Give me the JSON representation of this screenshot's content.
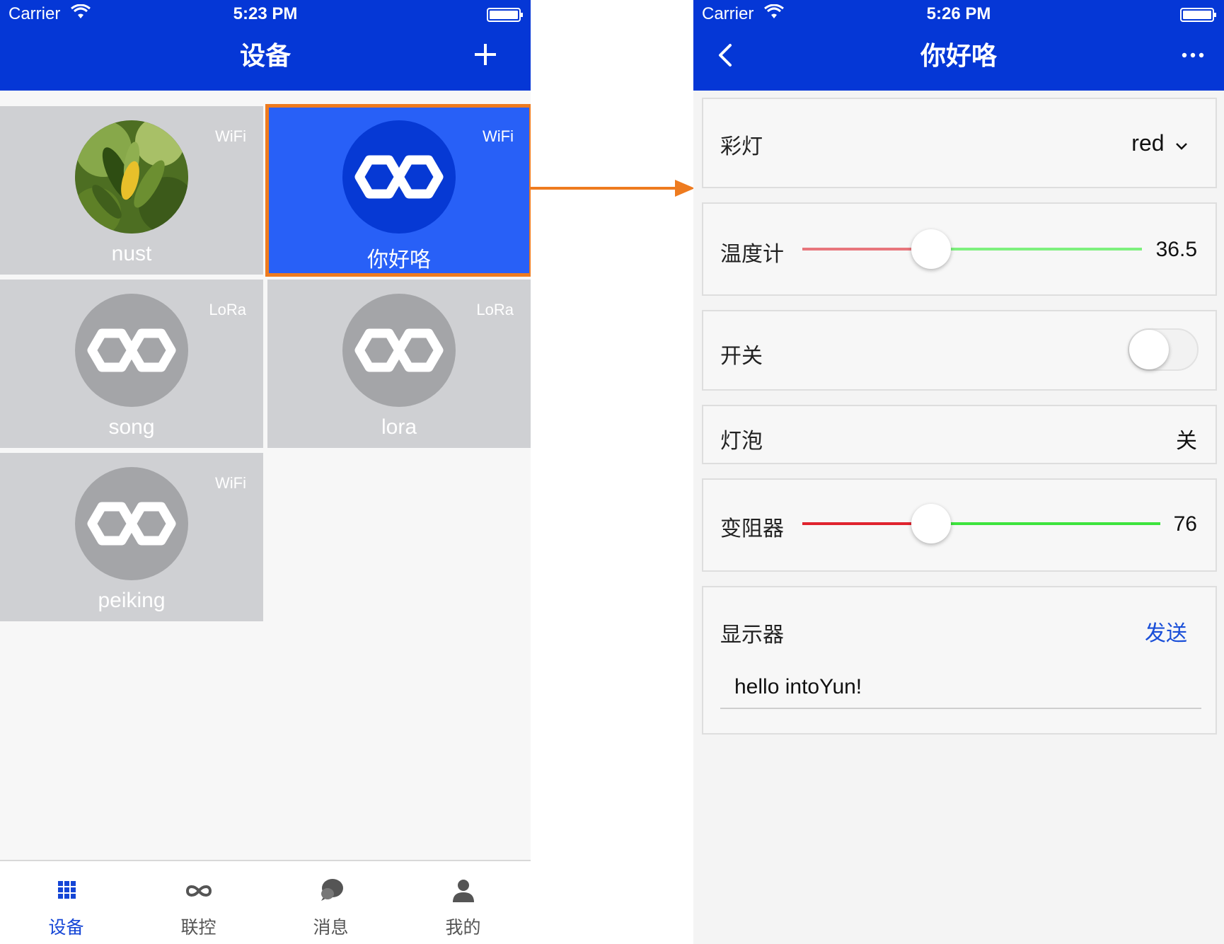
{
  "left_screen": {
    "status_bar": {
      "carrier": "Carrier",
      "time": "5:23 PM"
    },
    "title": "设备",
    "devices": [
      {
        "name": "nust",
        "network": "WiFi"
      },
      {
        "name": "你好咯",
        "network": "WiFi"
      },
      {
        "name": "song",
        "network": "LoRa"
      },
      {
        "name": "lora",
        "network": "LoRa"
      },
      {
        "name": "peiking",
        "network": "WiFi"
      }
    ],
    "tabs": [
      {
        "label": "设备",
        "icon": "grid-icon"
      },
      {
        "label": "联控",
        "icon": "infinity-icon"
      },
      {
        "label": "消息",
        "icon": "chat-icon"
      },
      {
        "label": "我的",
        "icon": "person-icon"
      }
    ],
    "active_tab": 0,
    "selected_device": 1
  },
  "right_screen": {
    "status_bar": {
      "carrier": "Carrier",
      "time": "5:26 PM"
    },
    "title": "你好咯",
    "controls": {
      "color_light": {
        "label": "彩灯",
        "value": "red"
      },
      "thermometer": {
        "label": "温度计",
        "value": "36.5",
        "level": 0.38
      },
      "switch": {
        "label": "开关",
        "on": false
      },
      "bulb": {
        "label": "灯泡",
        "value": "关"
      },
      "rheostat": {
        "label": "变阻器",
        "value": "76",
        "level": 0.36
      },
      "display": {
        "label": "显示器",
        "send_label": "发送",
        "input_value": "hello intoYun!"
      }
    }
  },
  "colors": {
    "nav_blue": "#0537d6",
    "selected_tile": "#2860f7",
    "highlight_orange": "#ee7b1f",
    "tile_gray": "#cfd0d3",
    "slider_min_thermo": "#e8767c",
    "slider_max_thermo": "#7ef07e",
    "slider_min_rheo": "#e0232e",
    "slider_max_rheo": "#3de43d"
  }
}
